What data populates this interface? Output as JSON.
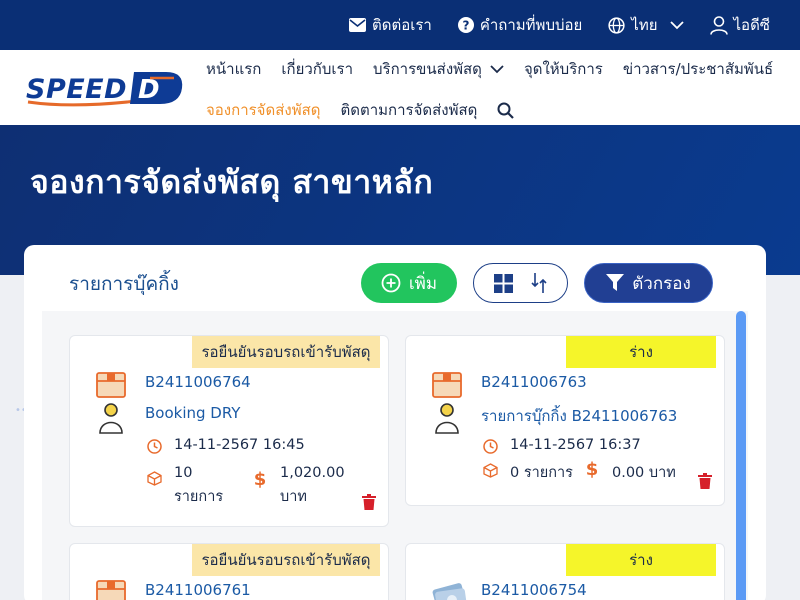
{
  "topbar": {
    "contact_label": "ติดต่อเรา",
    "faq_label": "คำถามที่พบบ่อย",
    "language_label": "ไทย",
    "user_label": "ไอดีซี"
  },
  "nav": {
    "home": "หน้าแรก",
    "about": "เกี่ยวกับเรา",
    "services": "บริการขนส่งพัสดุ",
    "service_points": "จุดให้บริการ",
    "news": "ข่าวสาร/ประชาสัมพันธ์",
    "booking": "จองการจัดส่งพัสดุ",
    "tracking": "ติดตามการจัดส่งพัสดุ"
  },
  "hero": {
    "title": "จองการจัดส่งพัสดุ สาขาหลัก"
  },
  "panel": {
    "title": "รายการบุ๊คกิ้ง",
    "add_label": "เพิ่ม",
    "filter_label": "ตัวกรอง"
  },
  "cards": [
    {
      "status": "รอยืนยันรอบรถเข้ารับพัสดุ",
      "id": "B2411006764",
      "name": "Booking DRY",
      "datetime": "14-11-2567 16:45",
      "items": "10",
      "items_unit": "รายการ",
      "amount": "1,020.00",
      "amount_unit": "บาท"
    },
    {
      "status": "ร่าง",
      "id": "B2411006763",
      "name": "รายการบุ๊กกิ้ง B2411006763",
      "datetime": "14-11-2567 16:37",
      "items_text": "0 รายการ",
      "amount_text": "0.00 บาท"
    },
    {
      "status": "รอยืนยันรอบรถเข้ารับพัสดุ",
      "id": "B2411006761"
    },
    {
      "status": "ร่าง",
      "id": "B2411006754"
    }
  ],
  "colors": {
    "topbar": "#0a2f75",
    "hero": "#0e2f73",
    "accent_orange": "#f0902a",
    "add_green": "#22c55e",
    "filter_blue": "#213f93",
    "badge_wait": "#fbe6a8",
    "badge_draft": "#f5f52a",
    "icon_orange": "#e86a2c",
    "trash_red": "#d6202a"
  }
}
